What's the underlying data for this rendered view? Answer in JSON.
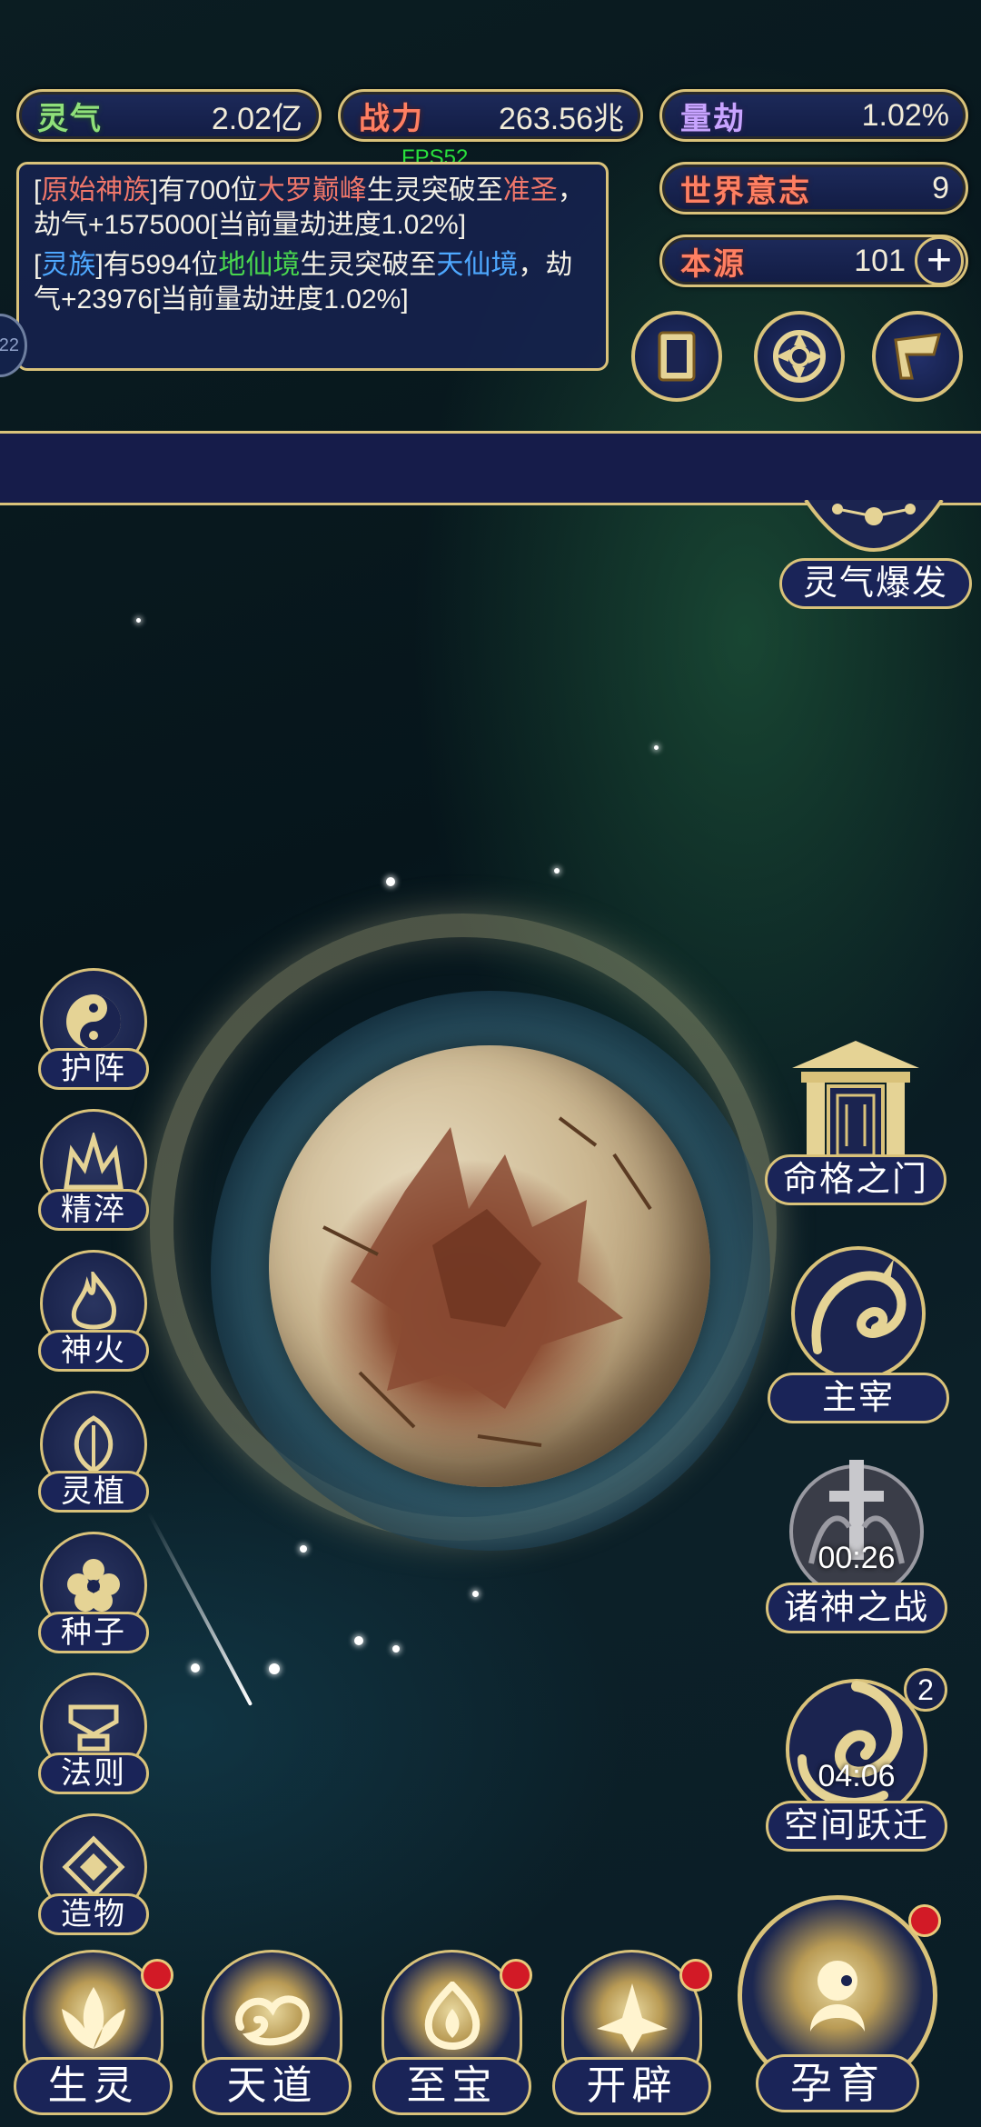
{
  "hud": {
    "fps": "FPS52",
    "stats": {
      "lingqi": {
        "label": "灵气",
        "value": "2.02亿"
      },
      "zhanli": {
        "label": "战力",
        "value": "263.56兆"
      },
      "liangjie": {
        "label": "量劫",
        "value": "1.02%"
      },
      "shijie": {
        "label": "世界意志",
        "value": "9"
      },
      "benyuan": {
        "label": "本源",
        "value": "101"
      }
    },
    "log": [
      {
        "parts": [
          "[",
          "原始神族",
          "]有700位",
          "大罗巅峰",
          "生灵突破至",
          "准圣",
          "，劫气+1575000[当前量劫进度1.02%]"
        ]
      },
      {
        "parts": [
          "[",
          "灵族",
          "]有5994位",
          "地仙境",
          "生灵突破至",
          "天仙境",
          "，劫气+23976[当前量劫进度1.02%]"
        ]
      }
    ],
    "side_tab": "22",
    "tool_icons": [
      "card-icon",
      "swirl-icon",
      "banner-icon"
    ]
  },
  "right_top": {
    "label": "灵气爆发"
  },
  "left_menu": [
    {
      "label": "护阵",
      "icon": "yin-yang-icon"
    },
    {
      "label": "精淬",
      "icon": "flame-crown-icon"
    },
    {
      "label": "神火",
      "icon": "fire-icon"
    },
    {
      "label": "灵植",
      "icon": "leaf-icon"
    },
    {
      "label": "种子",
      "icon": "flower-icon"
    },
    {
      "label": "法则",
      "icon": "rune-icon"
    },
    {
      "label": "造物",
      "icon": "diamond-icon"
    }
  ],
  "right_menu": {
    "gate": {
      "label": "命格之门"
    },
    "master": {
      "label": "主宰"
    },
    "gods_war": {
      "label": "诸神之战",
      "timer": "00:26"
    },
    "space_jump": {
      "label": "空间跃迁",
      "timer": "04:06",
      "badge": "2"
    }
  },
  "bottom_nav": [
    {
      "label": "生灵",
      "alert": true
    },
    {
      "label": "天道",
      "alert": false
    },
    {
      "label": "至宝",
      "alert": true
    },
    {
      "label": "开辟",
      "alert": true
    }
  ],
  "nurture": {
    "label": "孕育"
  },
  "colors": {
    "gold": "#d9c27a",
    "navy": "#1a2458",
    "alert": "#d21a26"
  }
}
